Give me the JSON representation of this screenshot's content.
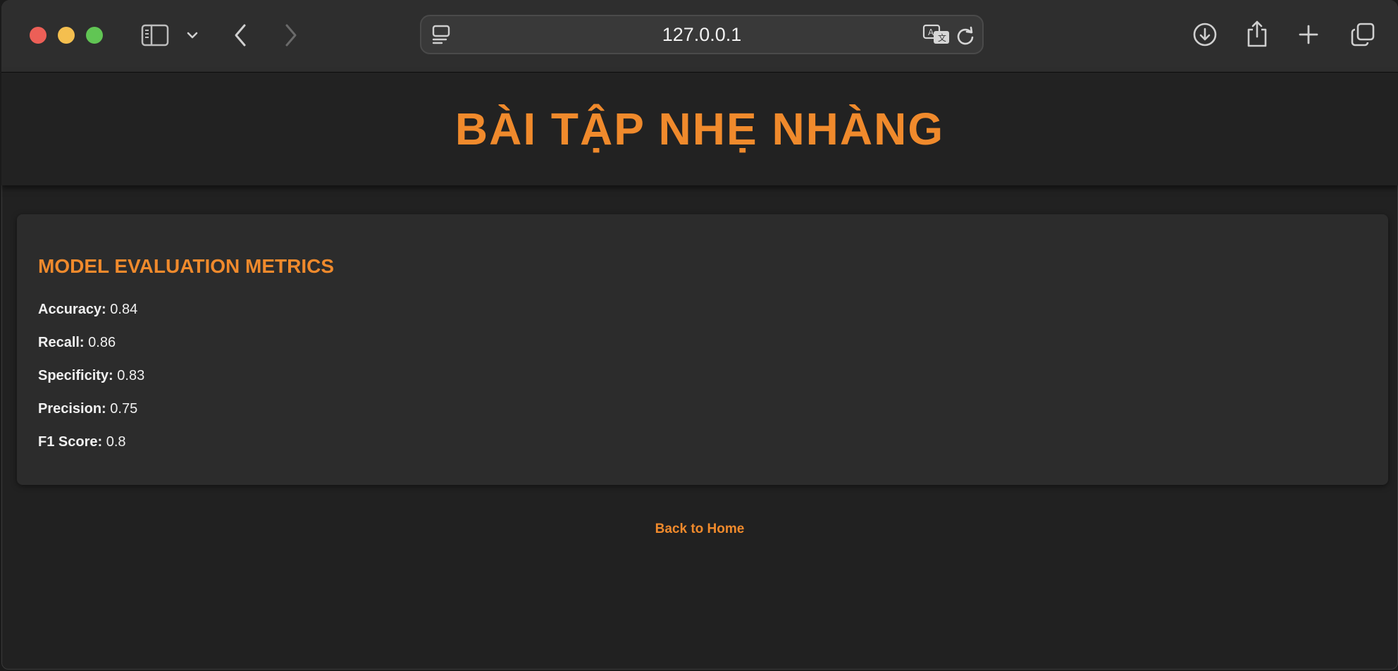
{
  "browser": {
    "url": "127.0.0.1",
    "icons": [
      "sidebar-icon",
      "chevron-down-icon",
      "back-icon",
      "forward-icon",
      "page-menu-icon",
      "translate-icon",
      "reload-icon",
      "download-icon",
      "share-icon",
      "new-tab-icon",
      "tabs-overview-icon"
    ]
  },
  "page": {
    "title": "BÀI TẬP NHẸ NHÀNG",
    "accent_color": "#f08a2c",
    "card": {
      "title": "MODEL EVALUATION METRICS",
      "metrics": [
        {
          "label": "Accuracy:",
          "value": "0.84"
        },
        {
          "label": "Recall:",
          "value": "0.86"
        },
        {
          "label": "Specificity:",
          "value": "0.83"
        },
        {
          "label": "Precision:",
          "value": "0.75"
        },
        {
          "label": "F1 Score:",
          "value": "0.8"
        }
      ]
    },
    "back_link": "Back to Home"
  }
}
